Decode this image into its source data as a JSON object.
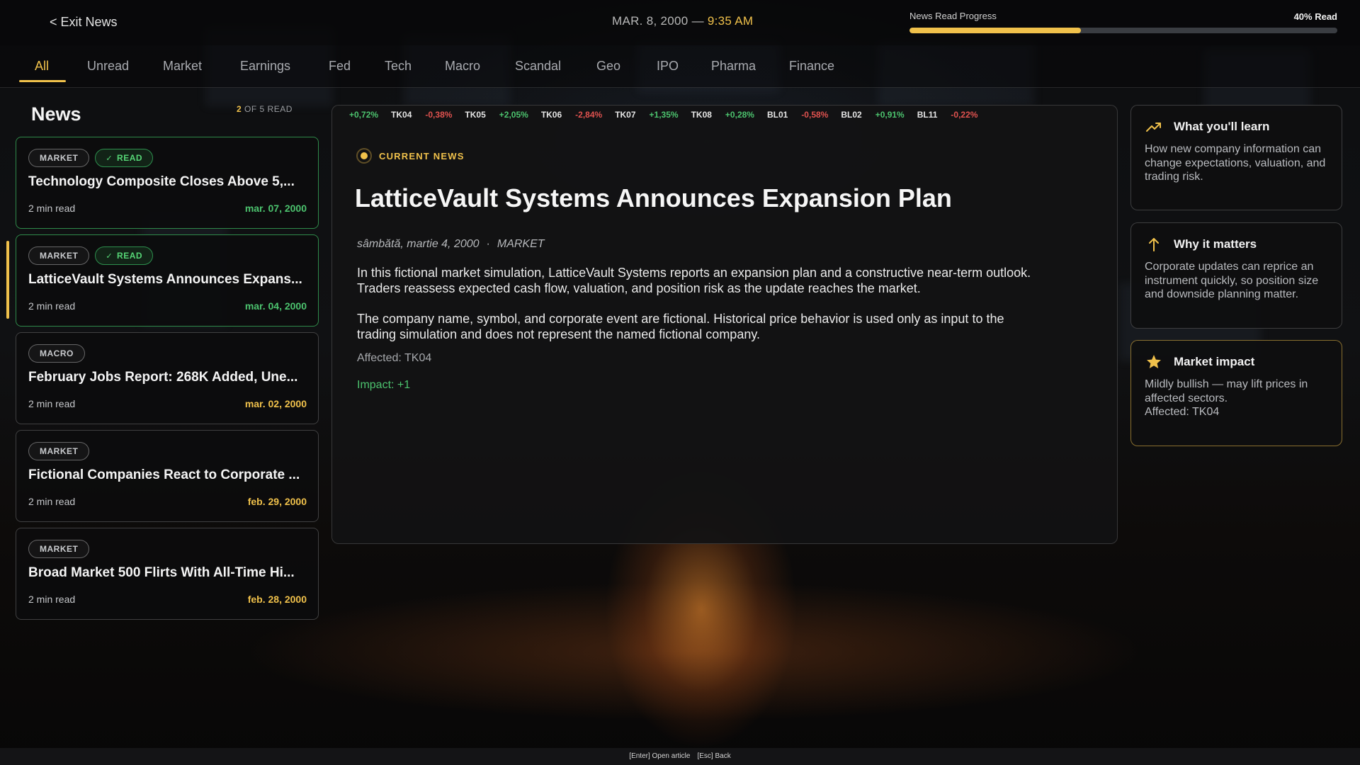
{
  "header": {
    "exit_label": "< Exit News",
    "date": "MAR. 8, 2000 — ",
    "time": "9:35 AM",
    "progress_label": "News Read Progress",
    "progress_text": "40% Read",
    "progress_fraction": 0.4
  },
  "tabs": [
    {
      "label": "All",
      "active": true
    },
    {
      "label": "Unread"
    },
    {
      "label": "Market"
    },
    {
      "label": "Earnings"
    },
    {
      "label": "Fed"
    },
    {
      "label": "Tech"
    },
    {
      "label": "Macro"
    },
    {
      "label": "Scandal"
    },
    {
      "label": "Geo"
    },
    {
      "label": "IPO"
    },
    {
      "label": "Pharma"
    },
    {
      "label": "Finance"
    }
  ],
  "news_list": {
    "title": "News",
    "read_count_num": "2",
    "read_count_text": " OF 5 READ",
    "items": [
      {
        "category": "MARKET",
        "read": true,
        "read_label": "READ",
        "headline": "Technology Composite Closes Above 5,...",
        "mins": "2 min read",
        "date": "mar. 07, 2000"
      },
      {
        "category": "MARKET",
        "read": true,
        "read_label": "READ",
        "headline": "LatticeVault Systems Announces Expans...",
        "mins": "2 min read",
        "date": "mar. 04, 2000"
      },
      {
        "category": "MACRO",
        "read": false,
        "headline": "February Jobs Report: 268K Added, Une...",
        "mins": "2 min read",
        "date": "mar. 02, 2000"
      },
      {
        "category": "MARKET",
        "read": false,
        "headline": "Fictional Companies React to Corporate ...",
        "mins": "2 min read",
        "date": "feb. 29, 2000"
      },
      {
        "category": "MARKET",
        "read": false,
        "headline": "Broad Market 500 Flirts With All-Time Hi...",
        "mins": "2 min read",
        "date": "feb. 28, 2000"
      }
    ]
  },
  "ticker": [
    {
      "change": "+0,72%",
      "symbol": "TK04",
      "dir": "up"
    },
    {
      "change": "-0,38%",
      "symbol": "TK05",
      "dir": "down"
    },
    {
      "change": "+2,05%",
      "symbol": "TK06",
      "dir": "up"
    },
    {
      "change": "-2,84%",
      "symbol": "TK07",
      "dir": "down"
    },
    {
      "change": "+1,35%",
      "symbol": "TK08",
      "dir": "up"
    },
    {
      "change": "+0,28%",
      "symbol": "BL01",
      "dir": "up"
    },
    {
      "change": "-0,58%",
      "symbol": "BL02",
      "dir": "down"
    },
    {
      "change": "+0,91%",
      "symbol": "BL11",
      "dir": "up"
    },
    {
      "change": "-0,22%",
      "symbol": "",
      "dir": "down"
    }
  ],
  "article": {
    "current_label": "CURRENT NEWS",
    "title": "LatticeVault Systems Announces Expansion Plan",
    "date": "sâmbătă, martie 4, 2000",
    "separator": "·",
    "category": "MARKET",
    "paragraph1": "In this fictional market simulation, LatticeVault Systems reports an expansion plan and a constructive near-term outlook. Traders reassess expected cash flow, valuation, and position risk as the update reaches the market.",
    "paragraph2": "The company name, symbol, and corporate event are fictional. Historical price behavior is used only as input to the trading simulation and does not represent the named fictional company.",
    "affected": "Affected: TK04",
    "impact": "Impact: +1"
  },
  "sidebar": {
    "learn": {
      "icon": "trend-up-icon",
      "title": "What you'll learn",
      "text": "How new company information can change expectations, valuation, and trading risk."
    },
    "matters": {
      "icon": "arrow-up-icon",
      "title": "Why it matters",
      "text": "Corporate updates can reprice an instrument quickly, so position size and downside planning matter."
    },
    "impact": {
      "icon": "star-icon",
      "title": "Market impact",
      "text": "Mildly bullish — may lift prices in affected sectors.",
      "affected": "Affected: TK04"
    }
  },
  "footer": {
    "hint1": "[Enter] Open article",
    "hint2": "[Esc] Back"
  },
  "colors": {
    "accent": "#f0c14b",
    "positive": "#4cc36e",
    "negative": "#e0524f"
  }
}
